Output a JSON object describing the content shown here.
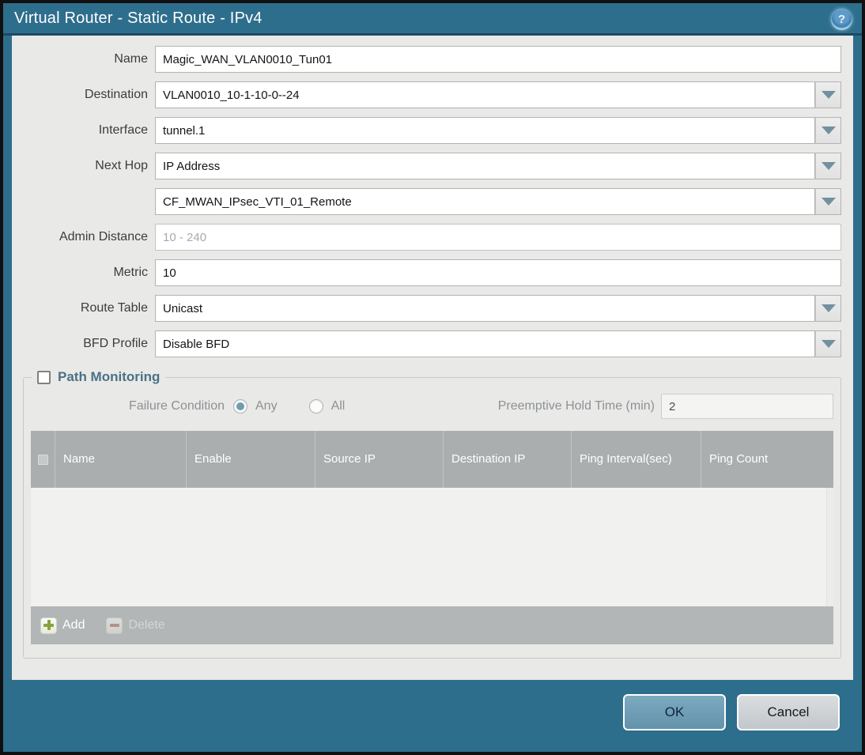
{
  "dialog": {
    "title": "Virtual Router - Static Route - IPv4",
    "help_glyph": "?"
  },
  "form": {
    "name": {
      "label": "Name",
      "value": "Magic_WAN_VLAN0010_Tun01"
    },
    "destination": {
      "label": "Destination",
      "value": "VLAN0010_10-1-10-0--24"
    },
    "interface": {
      "label": "Interface",
      "value": "tunnel.1"
    },
    "next_hop": {
      "label": "Next Hop",
      "type_value": "IP Address",
      "address_value": "CF_MWAN_IPsec_VTI_01_Remote"
    },
    "admin_distance": {
      "label": "Admin Distance",
      "placeholder": "10 - 240"
    },
    "metric": {
      "label": "Metric",
      "value": "10"
    },
    "route_table": {
      "label": "Route Table",
      "value": "Unicast"
    },
    "bfd_profile": {
      "label": "BFD Profile",
      "value": "Disable BFD"
    }
  },
  "path_monitoring": {
    "title": "Path Monitoring",
    "enabled": false,
    "failure_condition": {
      "label": "Failure Condition",
      "options": [
        "Any",
        "All"
      ],
      "selected": "Any"
    },
    "preemptive_hold_time": {
      "label": "Preemptive Hold Time (min)",
      "value": "2"
    },
    "table": {
      "columns": [
        "Name",
        "Enable",
        "Source IP",
        "Destination IP",
        "Ping Interval(sec)",
        "Ping Count"
      ],
      "rows": []
    },
    "toolbar": {
      "add_label": "Add",
      "delete_label": "Delete"
    }
  },
  "footer": {
    "ok_label": "OK",
    "cancel_label": "Cancel"
  },
  "colors": {
    "titlebar_teal": "#2e6e8d",
    "ok_button_blue": "#6f9db7",
    "table_header_gray": "#aaaeae",
    "add_icon_green": "#86a43c",
    "delete_icon_red": "#b5736d",
    "pm_title_slate": "#4a7186"
  }
}
